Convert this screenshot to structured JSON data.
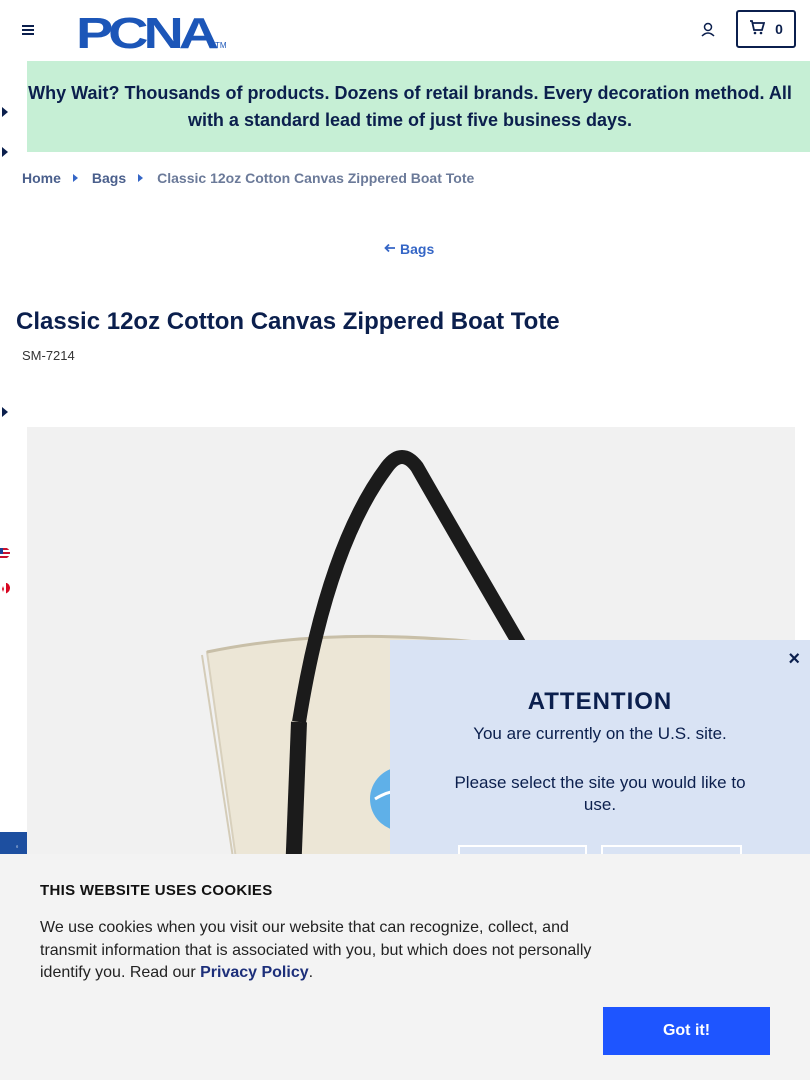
{
  "header": {
    "logo_text": "PCNA",
    "logo_tm": "™",
    "cart_count": "0"
  },
  "banner": {
    "text": "Why Wait? Thousands of products. Dozens of retail brands. Every decoration method. All with a standard lead time of just five business days."
  },
  "breadcrumb": {
    "items": [
      "Home",
      "Bags"
    ],
    "current": "Classic 12oz Cotton Canvas Zippered Boat Tote"
  },
  "back_link": "Bags",
  "product": {
    "title": "Classic 12oz Cotton Canvas Zippered Boat Tote",
    "sku": "SM-7214"
  },
  "modal": {
    "close": "×",
    "title": "ATTENTION",
    "line1": "You are currently on the U.S. site.",
    "line2": "Please select the site you would like to use."
  },
  "cookie": {
    "title": "THIS WEBSITE USES COOKIES",
    "text": "We use cookies when you visit our website that can recognize, collect, and transmit information that is associated with you, but which does not personally identify you. Read our ",
    "link": "Privacy Policy",
    "after": ".",
    "button": "Got it!"
  },
  "colors": {
    "navy": "#0b1f4d",
    "banner_bg": "#c6efd5",
    "accent_blue": "#3566c6",
    "cookie_button": "#1e55ff",
    "modal_bg": "#d9e3f4"
  }
}
